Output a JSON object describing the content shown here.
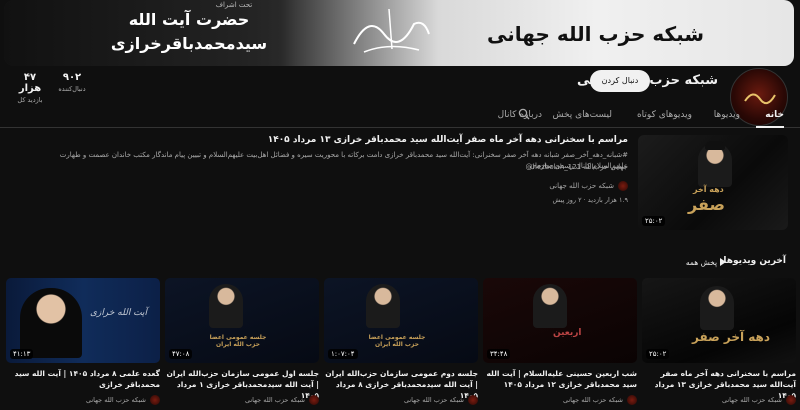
{
  "banner": {
    "subtitle": "تحت اشراف",
    "name_line1": "حضرت آیت الله",
    "name_line2": "سیدمحمدباقرخرازی",
    "channel_name": "شبکه حزب الله جهانی"
  },
  "channel": {
    "title": "شبکه حزب الله جهانی",
    "subscribe_label": "دنبال کردن",
    "stats": [
      {
        "value": "۹۰۲",
        "label": "دنبال‌کننده"
      },
      {
        "value": "۴۷ هزار",
        "label": "بازدید کل"
      }
    ]
  },
  "tabs": [
    {
      "label": "خانه",
      "active": true
    },
    {
      "label": "ویدیوها",
      "active": false
    },
    {
      "label": "ویدیوهای کوتاه",
      "active": false
    },
    {
      "label": "لیست‌های پخش",
      "active": false
    },
    {
      "label": "درباره کانال",
      "active": false
    }
  ],
  "featured": {
    "title": "مراسم با سخنرانی دهه آخر ماه صفر آیت‌الله سید محمدباقر خرازی ۱۳ مرداد ۱۴۰۵",
    "description_1": "#شبانه_دهه_آخر_صفر شبانه دهه آخر صفر سخنرانی: آیت‌الله سید محمدباقر خرازی دامت برکاته با محوریت سیره و فضائل اهل‌بیت علیهم‌السلام و تبیین پیام ماندگار مکتب خاندان عصمت و طهارت علیهم‌السلام کانال رسمی سازمان",
    "description_2": "جهانی حزب‌الله hezbolah_121@",
    "channel": "شبکه حزب الله جهانی",
    "meta": "۱.۹ هزار بازدید · ۲ روز پیش",
    "duration": "۲۵:۰۲",
    "thumb_text_1": "دهه آخر",
    "thumb_text_2": "صفر"
  },
  "section": {
    "title": "آخرین ویدیوها",
    "play_all": "پخش همه"
  },
  "cards": [
    {
      "title": "مراسم با سخنرانی دهه آخر ماه صفر آیت‌الله سید محمدباقر خرازی ۱۳ مرداد ۱۴۰۵",
      "channel": "شبکه حزب الله جهانی",
      "duration": "۲۵:۰۲",
      "thumb_text": "دهه آخر صفر"
    },
    {
      "title": "شب اربعین حسینی علیه‌السلام | آیت الله سید محمدباقر خرازی ۱۲ مرداد ۱۴۰۵",
      "channel": "شبکه حزب الله جهانی",
      "duration": "۳۴:۴۸",
      "thumb_text": "اربعین"
    },
    {
      "title": "جلسه دوم عمومی سازمان حزب‌الله ایران | آیت الله سیدمحمدباقر خرازی ۸ مرداد ۱۴۰۵",
      "channel": "شبکه حزب الله جهانی",
      "duration": "۱:۰۷:۰۴",
      "thumb_text": "جلسه عمومی اعضا حزب الله ایران"
    },
    {
      "title": "جلسه اول عمومی سازمان حزب‌الله ایران | آیت الله سیدمحمدباقر خرازی ۱ مرداد ۱۴۰۵",
      "channel": "شبکه حزب الله جهانی",
      "duration": "۴۷:۰۸",
      "thumb_text": "جلسه عمومی اعضا حزب الله ایران"
    },
    {
      "title": "گعده علمی ۸ مرداد ۱۴۰۵ | آیت الله سید محمدباقر خرازی",
      "channel": "شبکه حزب الله جهانی",
      "duration": "۴۱:۱۳",
      "thumb_text": "آیت الله خرازی"
    }
  ],
  "icons": {
    "search": "search-icon",
    "play": "play-icon"
  }
}
